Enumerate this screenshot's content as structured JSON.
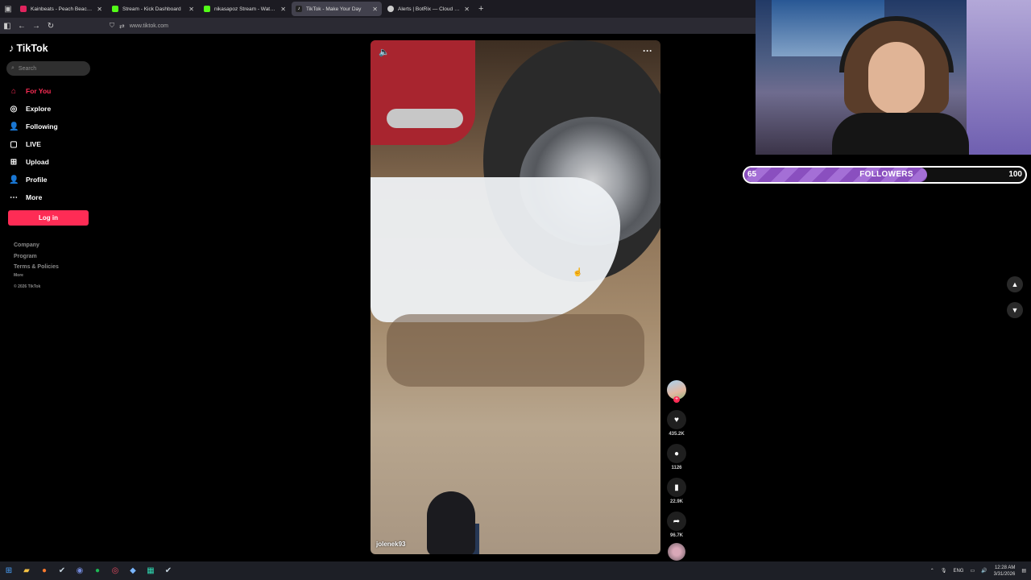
{
  "browser": {
    "tabs": [
      {
        "label": "Kainbeats - Peach Beach [Lofi H",
        "color": "#e0245e",
        "active": false
      },
      {
        "label": "Stream - Kick Dashboard",
        "color": "#53fc18",
        "active": false
      },
      {
        "label": "nikasapoz Stream - Watch Live",
        "color": "#53fc18",
        "active": false
      },
      {
        "label": "TikTok - Make Your Day",
        "color": "#ffffff",
        "active": true
      },
      {
        "label": "Alerts | BotRix — Cloud Stream",
        "color": "#cccccc",
        "active": false
      }
    ],
    "url": "www.tiktok.com"
  },
  "tiktok": {
    "logo": "TikTok",
    "search_placeholder": "Search",
    "menu": [
      {
        "label": "For You",
        "icon": "home-icon"
      },
      {
        "label": "Explore",
        "icon": "compass-icon"
      },
      {
        "label": "Following",
        "icon": "following-icon"
      },
      {
        "label": "LIVE",
        "icon": "live-icon"
      },
      {
        "label": "Upload",
        "icon": "upload-icon"
      },
      {
        "label": "Profile",
        "icon": "profile-icon"
      },
      {
        "label": "More",
        "icon": "more-icon"
      }
    ],
    "login_label": "Log in",
    "footer": {
      "company": "Company",
      "program": "Program",
      "terms": "Terms & Policies",
      "more": "More",
      "copyright": "© 2026 TikTok"
    }
  },
  "video": {
    "username": "jolenek93",
    "likes": "435.2K",
    "comments": "1126",
    "saves": "22.9K",
    "shares": "96.7K"
  },
  "overlay": {
    "followers_current": "65",
    "followers_label": "FOLLOWERS",
    "followers_goal": "100",
    "progress_fraction": 0.65
  },
  "taskbar": {
    "lang": "ENG",
    "time": "12:28 AM",
    "date": "3/31/2026"
  }
}
